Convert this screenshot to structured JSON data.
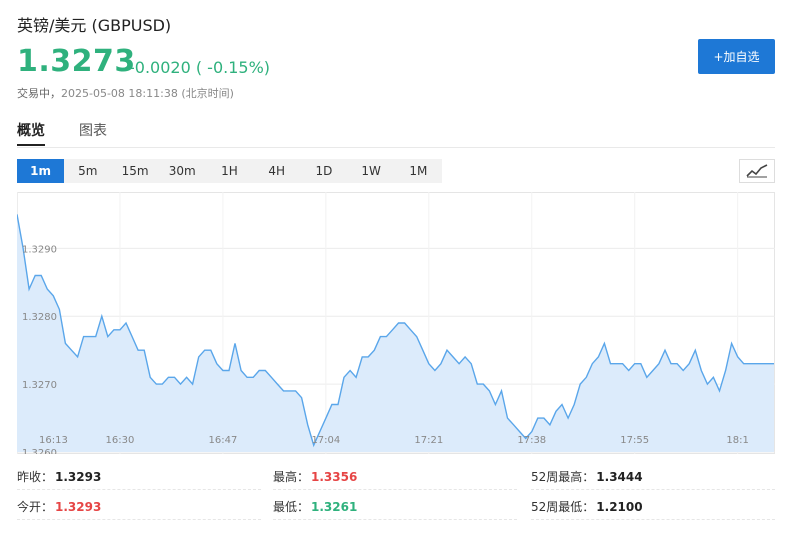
{
  "header": {
    "title": "英镑/美元 (GBPUSD)",
    "price": "1.3273",
    "change": "-0.0020 ( -0.15%)",
    "status_label": "交易中，",
    "timestamp": "2025-05-08 18:11:38 (北京时间)",
    "add_watchlist_label": "+加自选"
  },
  "tabs": [
    {
      "label": "概览",
      "active": true
    },
    {
      "label": "图表",
      "active": false
    }
  ],
  "intervals": [
    "1m",
    "5m",
    "15m",
    "30m",
    "1H",
    "4H",
    "1D",
    "1W",
    "1M"
  ],
  "active_interval": "1m",
  "icons": {
    "chart_type": "line-chart-icon"
  },
  "colors": {
    "up": "#e64545",
    "down": "#2fb17d",
    "accent": "#1e78d6",
    "area_fill": "#dcebfb",
    "line": "#5aa6ea"
  },
  "chart_data": {
    "type": "area",
    "ylim": [
      1.326,
      1.3298
    ],
    "yticks": [
      "1.3290",
      "1.3280",
      "1.3270",
      "1.3260"
    ],
    "xticks": [
      "16:13",
      "16:30",
      "16:47",
      "17:04",
      "17:21",
      "17:38",
      "17:55",
      "18:1"
    ],
    "x_minutes": [
      0,
      1,
      2,
      3,
      4,
      5,
      6,
      7,
      8,
      9,
      10,
      11,
      12,
      13,
      14,
      15,
      16,
      17,
      18,
      19,
      20,
      21,
      22,
      23,
      24,
      25,
      26,
      27,
      28,
      29,
      30,
      31,
      32,
      33,
      34,
      35,
      36,
      37,
      38,
      39,
      40,
      41,
      42,
      43,
      44,
      45,
      46,
      47,
      48,
      49,
      50,
      51,
      52,
      53,
      54,
      55,
      56,
      57,
      58,
      59,
      60,
      61,
      62,
      63,
      64,
      65,
      66,
      67,
      68,
      69,
      70,
      71,
      72,
      73,
      74,
      75,
      76,
      77,
      78,
      79,
      80,
      81,
      82,
      83,
      84,
      85,
      86,
      87,
      88,
      89,
      90,
      91,
      92,
      93,
      94,
      95,
      96,
      97,
      98,
      99,
      100,
      101,
      102,
      103,
      104,
      105,
      106,
      107,
      108,
      109,
      110,
      111,
      112,
      113,
      114,
      115,
      116,
      117,
      118,
      119,
      120,
      121,
      122,
      123,
      124,
      125
    ],
    "series": [
      {
        "values": [
          1.3295,
          1.329,
          1.3284,
          1.3286,
          1.3286,
          1.3284,
          1.3283,
          1.3281,
          1.3276,
          1.3275,
          1.3274,
          1.3277,
          1.3277,
          1.3277,
          1.328,
          1.3277,
          1.3278,
          1.3278,
          1.3279,
          1.3277,
          1.3275,
          1.3275,
          1.3271,
          1.327,
          1.327,
          1.3271,
          1.3271,
          1.327,
          1.3271,
          1.327,
          1.3274,
          1.3275,
          1.3275,
          1.3273,
          1.3272,
          1.3272,
          1.3276,
          1.3272,
          1.3271,
          1.3271,
          1.3272,
          1.3272,
          1.3271,
          1.327,
          1.3269,
          1.3269,
          1.3269,
          1.3268,
          1.3264,
          1.3261,
          1.3263,
          1.3265,
          1.3267,
          1.3267,
          1.3271,
          1.3272,
          1.3271,
          1.3274,
          1.3274,
          1.3275,
          1.3277,
          1.3277,
          1.3278,
          1.3279,
          1.3279,
          1.3278,
          1.3277,
          1.3275,
          1.3273,
          1.3272,
          1.3273,
          1.3275,
          1.3274,
          1.3273,
          1.3274,
          1.3273,
          1.327,
          1.327,
          1.3269,
          1.3267,
          1.3269,
          1.3265,
          1.3264,
          1.3263,
          1.3262,
          1.3263,
          1.3265,
          1.3265,
          1.3264,
          1.3266,
          1.3267,
          1.3265,
          1.3267,
          1.327,
          1.3271,
          1.3273,
          1.3274,
          1.3276,
          1.3273,
          1.3273,
          1.3273,
          1.3272,
          1.3273,
          1.3273,
          1.3271,
          1.3272,
          1.3273,
          1.3275,
          1.3273,
          1.3273,
          1.3272,
          1.3273,
          1.3275,
          1.3272,
          1.327,
          1.3271,
          1.3269,
          1.3272,
          1.3276,
          1.3274,
          1.3273,
          1.3273,
          1.3273,
          1.3273,
          1.3273,
          1.3273
        ]
      }
    ]
  },
  "stats": {
    "prev_close_label": "昨收：",
    "prev_close": "1.3293",
    "high_label": "最高：",
    "high": "1.3356",
    "high52_label": "52周最高：",
    "high52": "1.3444",
    "open_label": "今开：",
    "open": "1.3293",
    "low_label": "最低：",
    "low": "1.3261",
    "low52_label": "52周最低：",
    "low52": "1.2100"
  }
}
